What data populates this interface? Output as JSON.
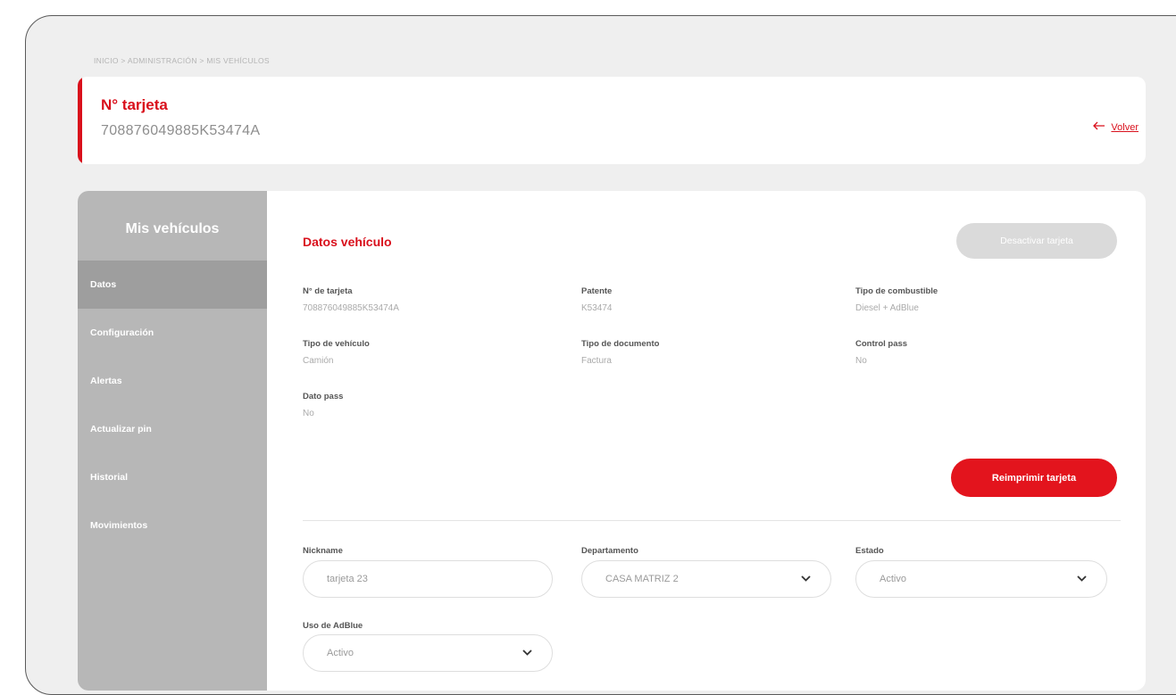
{
  "breadcrumb": "INICIO > ADMINISTRACIÓN > MIS VEHÍCULOS",
  "header": {
    "title": "N° tarjeta",
    "card_number": "708876049885K53474A",
    "back_label": "Volver"
  },
  "sidebar": {
    "title": "Mis vehículos",
    "items": [
      {
        "label": "Datos",
        "active": true
      },
      {
        "label": "Configuración"
      },
      {
        "label": "Alertas"
      },
      {
        "label": "Actualizar pin"
      },
      {
        "label": "Historial"
      },
      {
        "label": "Movimientos"
      }
    ]
  },
  "main": {
    "section_title": "Datos vehículo",
    "deactivate_label": "Desactivar tarjeta",
    "reprint_label": "Reimprimir tarjeta",
    "fields": {
      "card_number": {
        "label": "N° de tarjeta",
        "value": "708876049885K53474A"
      },
      "plate": {
        "label": "Patente",
        "value": "K53474"
      },
      "fuel_type": {
        "label": "Tipo de combustible",
        "value": "Diesel + AdBlue"
      },
      "vehicle_type": {
        "label": "Tipo de vehículo",
        "value": "Camión"
      },
      "document_type": {
        "label": "Tipo de documento",
        "value": "Factura"
      },
      "pass_control": {
        "label": "Control pass",
        "value": "No"
      },
      "pass_data": {
        "label": "Dato pass",
        "value": "No"
      }
    },
    "form": {
      "nickname": {
        "label": "Nickname",
        "value": "tarjeta 23"
      },
      "department": {
        "label": "Departamento",
        "value": "CASA MATRIZ 2"
      },
      "status": {
        "label": "Estado",
        "value": "Activo"
      },
      "adblue": {
        "label": "Uso de AdBlue",
        "value": "Activo"
      }
    }
  },
  "colors": {
    "accent": "#d9101c",
    "sidebar": "#b7b7b7",
    "sidebar_active": "#9e9e9e",
    "background": "#efefef"
  },
  "icons": {
    "back": "arrow-left-icon",
    "dropdown": "chevron-down-icon"
  }
}
